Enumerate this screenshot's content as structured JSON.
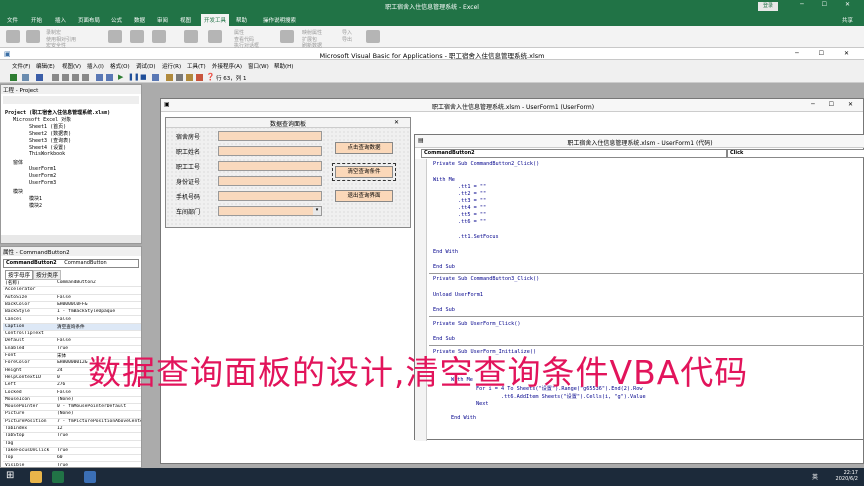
{
  "excel": {
    "title": "职工宿舍入住信息管理系统 - Excel",
    "login": "登录",
    "share": "共享",
    "menu": [
      "文件",
      "开始",
      "插入",
      "页面布局",
      "公式",
      "数据",
      "审阅",
      "视图",
      "开发工具",
      "帮助",
      "操作说明搜索"
    ],
    "ribbon": [
      "录制宏",
      "使用相对引用",
      "宏安全性",
      "属性",
      "查看代码",
      "执行对话框",
      "映射属性",
      "扩展包",
      "刷新数据",
      "导入",
      "导出"
    ]
  },
  "vbe": {
    "title": "Microsoft Visual Basic for Applications - 职工宿舍入住信息管理系统.xlsm",
    "menu": [
      "文件(F)",
      "编辑(E)",
      "视图(V)",
      "插入(I)",
      "格式(O)",
      "调试(D)",
      "运行(R)",
      "工具(T)",
      "外接程序(A)",
      "窗口(W)",
      "帮助(H)"
    ],
    "position": "行 63，列 1"
  },
  "project": {
    "title": "工程 - Project",
    "tree": [
      "Project (职工宿舍入住信息管理系统.xlsm)",
      "Microsoft Excel 对象",
      "Sheet1 (首页)",
      "Sheet2 (数据表)",
      "Sheet3 (查询表)",
      "Sheet4 (设置)",
      "ThisWorkbook",
      "窗体",
      "UserForm1",
      "UserForm2",
      "UserForm3",
      "模块",
      "模块1",
      "模块2"
    ]
  },
  "properties": {
    "title": "属性 - CommandButton2",
    "object": "CommandButton2",
    "type": "CommandButton",
    "tabs": [
      "按字母序",
      "按分类序"
    ],
    "rows": [
      [
        "(名称)",
        "CommandButton2"
      ],
      [
        "Accelerator",
        ""
      ],
      [
        "AutoSize",
        "False"
      ],
      [
        "BackColor",
        "&H0000C0FF&"
      ],
      [
        "BackStyle",
        "1 - fmBackStyleOpaque"
      ],
      [
        "Cancel",
        "False"
      ],
      [
        "Caption",
        "清空查询条件"
      ],
      [
        "ControlTipText",
        ""
      ],
      [
        "Default",
        "False"
      ],
      [
        "Enabled",
        "True"
      ],
      [
        "Font",
        "宋体"
      ],
      [
        "ForeColor",
        "&H80000012&"
      ],
      [
        "Height",
        "24"
      ],
      [
        "HelpContextID",
        "0"
      ],
      [
        "Left",
        "276"
      ],
      [
        "Locked",
        "False"
      ],
      [
        "MouseIcon",
        "(None)"
      ],
      [
        "MousePointer",
        "0 - fmMousePointerDefault"
      ],
      [
        "Picture",
        "(None)"
      ],
      [
        "PicturePosition",
        "7 - fmPicturePositionAboveCenter"
      ],
      [
        "TabIndex",
        "12"
      ],
      [
        "TabStop",
        "True"
      ],
      [
        "Tag",
        ""
      ],
      [
        "TakeFocusOnClick",
        "True"
      ],
      [
        "Top",
        "60"
      ],
      [
        "Visible",
        "True"
      ],
      [
        "Width",
        "96"
      ],
      [
        "WordWrap",
        "False"
      ]
    ]
  },
  "userform_window": {
    "title": "职工宿舍入住信息管理系统.xlsm - UserForm1 (UserForm)"
  },
  "form": {
    "title": "数据查询面板",
    "labels": [
      "宿舍房号",
      "职工姓名",
      "职工工号",
      "身份证号",
      "手机号码",
      "车间部门"
    ],
    "buttons": [
      "点击查询数据",
      "清空查询条件",
      "退出查询界面"
    ]
  },
  "code_window": {
    "title": "职工宿舍入住信息管理系统.xlsm - UserForm1 (代码)",
    "object": "CommandButton2",
    "proc": "Click",
    "lines": [
      "Private Sub CommandButton2_Click()",
      "With Me",
      "        .tt1 = \"\"",
      "        .tt2 = \"\"",
      "        .tt3 = \"\"",
      "        .tt4 = \"\"",
      "        .tt5 = \"\"",
      "        .tt6 = \"\"",
      "        .tt1.SetFocus",
      "End With",
      "End Sub",
      "Private Sub CommandButton3_Click()",
      "Unload UserForm1",
      "End Sub",
      "Private Sub UserForm_Click()",
      "End Sub",
      "Private Sub UserForm_Initialize()",
      "With Me",
      "        For i = 4 To Sheets(\"设置\").Range(\"g65536\").End(2).Row",
      "                .tt6.AddItem Sheets(\"设置\").Cells(i, \"g\").Value",
      "        Next",
      "End With"
    ]
  },
  "caption": "数据查询面板的设计,清空查询条件VBA代码",
  "taskbar": {
    "time": "22:17",
    "date": "2020/6/2",
    "ime": "英"
  }
}
